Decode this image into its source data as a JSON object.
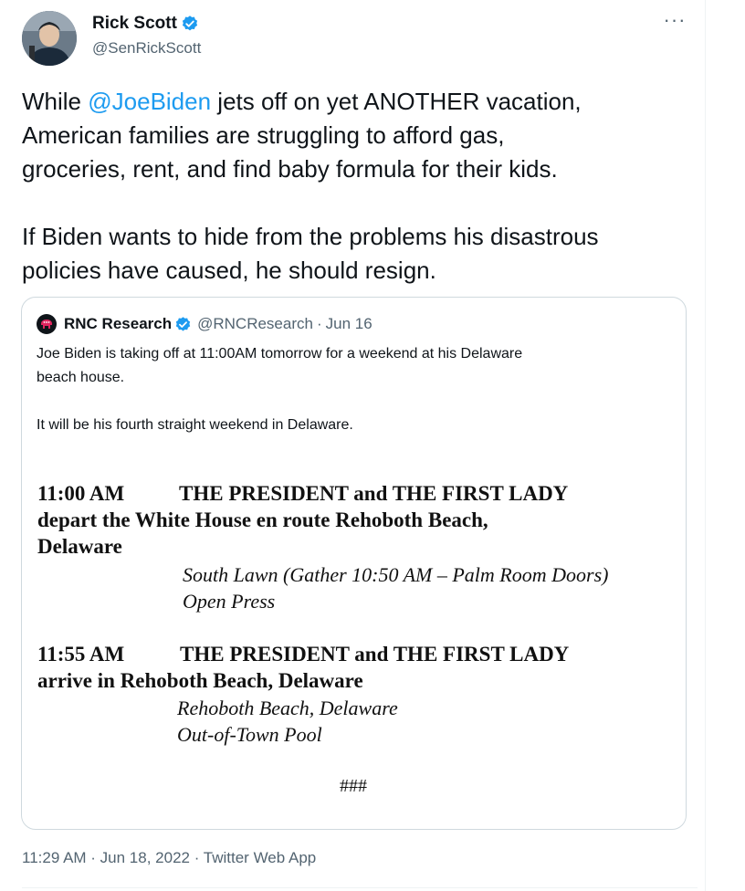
{
  "author": {
    "name": "Rick Scott",
    "handle": "@SenRickScott",
    "verified_icon": "verified-badge-icon",
    "avatar_icon": "avatar-photo"
  },
  "more_label": "···",
  "tweet": {
    "text_before_mention": "While ",
    "mention": "@JoeBiden",
    "text_after_mention": " jets off on yet ANOTHER vacation,\nAmerican families are struggling to afford gas,\ngroceries, rent, and find baby formula for their kids.\n\nIf Biden wants to hide from the problems his disastrous\npolicies have caused, he should resign."
  },
  "quoted_tweet": {
    "name": "RNC Research",
    "handle": "@RNCResearch",
    "separator": "·",
    "date": "Jun 16",
    "text": "Joe Biden is taking off at 11:00AM tomorrow for a weekend at his Delaware\nbeach house.\n\nIt will be his fourth straight weekend in Delaware.",
    "schedule_image": {
      "entry1_time": "11:00 AM",
      "entry1_line1": "THE PRESIDENT and THE FIRST LADY",
      "entry1_line2": "depart the White House en route Rehoboth Beach,",
      "entry1_line3": "Delaware",
      "entry1_location": "South Lawn (Gather 10:50 AM – Palm Room Doors)",
      "entry1_press": "Open Press",
      "entry2_time": "11:55 AM",
      "entry2_line1": "THE PRESIDENT and THE FIRST LADY",
      "entry2_line2": "arrive in Rehoboth Beach, Delaware",
      "entry2_location": "Rehoboth Beach, Delaware",
      "entry2_press": "Out-of-Town Pool",
      "end_mark": "###"
    }
  },
  "timestamp": "11:29 AM · Jun 18, 2022 · Twitter Web App",
  "colors": {
    "link": "#1d9bf0",
    "secondary_text": "#536471",
    "border": "#cfd9de",
    "rnc_logo_red": "#e0245e"
  }
}
